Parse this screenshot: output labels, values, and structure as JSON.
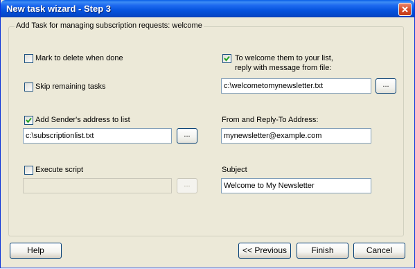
{
  "window": {
    "title": "New task wizard - Step 3"
  },
  "group": {
    "legend": "Add Task for managing subscription requests: welcome"
  },
  "left": {
    "mark_delete": {
      "label": "Mark to delete when done",
      "checked": false
    },
    "skip_remaining": {
      "label": "Skip remaining tasks",
      "checked": false
    },
    "add_sender": {
      "label": "Add Sender's address to list",
      "checked": true,
      "file": "c:\\subscriptionlist.txt",
      "browse_label": "..."
    },
    "execute_script": {
      "label": "Execute script",
      "checked": false,
      "file": "",
      "browse_label": "..."
    }
  },
  "right": {
    "welcome": {
      "label_line1": "To welcome them to your list,",
      "label_line2": "reply with message from file:",
      "checked": true,
      "file": "c:\\welcometomynewsletter.txt",
      "browse_label": "..."
    },
    "from_reply": {
      "label": "From and Reply-To Address:",
      "value": "mynewsletter@example.com"
    },
    "subject": {
      "label": "Subject",
      "value": "Welcome to My Newsletter"
    }
  },
  "footer": {
    "help": "Help",
    "previous": "<< Previous",
    "finish": "Finish",
    "cancel": "Cancel"
  }
}
